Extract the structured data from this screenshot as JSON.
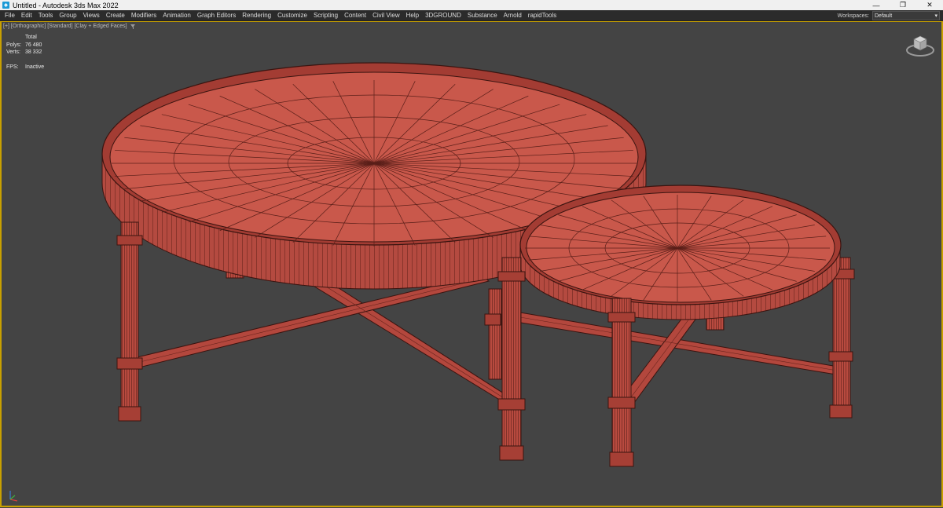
{
  "window": {
    "title": "Untitled - Autodesk 3ds Max 2022",
    "controls": [
      "minimize-icon",
      "restore-icon",
      "close-icon"
    ]
  },
  "menu": {
    "items": [
      "File",
      "Edit",
      "Tools",
      "Group",
      "Views",
      "Create",
      "Modifiers",
      "Animation",
      "Graph Editors",
      "Rendering",
      "Customize",
      "Scripting",
      "Content",
      "Civil View",
      "Help",
      "3DGROUND",
      "Substance",
      "Arnold",
      "rapidTools"
    ],
    "workspaces_label": "Workspaces:",
    "workspace_value": "Default"
  },
  "viewport": {
    "label": "[+] [Orthographic] [Standard] [Clay + Edged Faces]",
    "stats": {
      "header": "Total",
      "polys_label": "Polys:",
      "polys_value": "76 480",
      "verts_label": "Verts:",
      "verts_value": "38 332",
      "fps_label": "FPS:",
      "fps_value": "Inactive"
    }
  },
  "colors": {
    "clay": "#c8574a",
    "clay_dark": "#8e3229",
    "edge": "#3a1410",
    "viewport_bg": "#444444",
    "active_border": "#c8a000"
  },
  "icons": {
    "filter": "funnel-icon",
    "viewcube": "viewcube-icon",
    "axis": "axis-tripod-icon",
    "app": "3dsmax-icon"
  }
}
